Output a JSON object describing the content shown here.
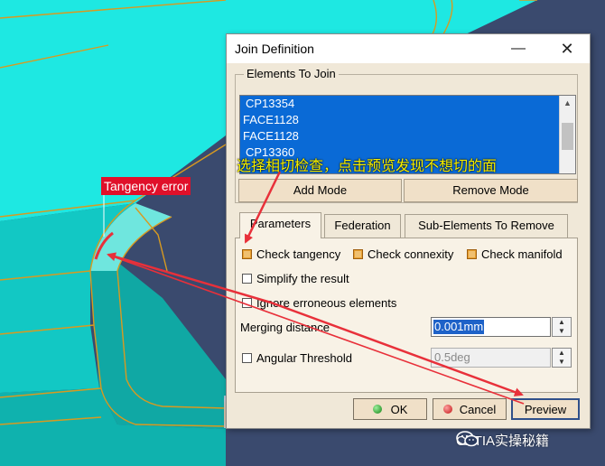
{
  "window": {
    "title": "Join Definition",
    "minimize_glyph": "—",
    "close_glyph": "✕"
  },
  "elements_to_join": {
    "legend": "Elements To Join",
    "items": [
      "CP13354",
      "FACE1128",
      "FACE1128",
      "CP13360"
    ],
    "add_mode_label": "Add Mode",
    "remove_mode_label": "Remove Mode"
  },
  "tabs": [
    {
      "label": "Parameters",
      "active": true
    },
    {
      "label": "Federation",
      "active": false
    },
    {
      "label": "Sub-Elements To Remove",
      "active": false
    }
  ],
  "parameters": {
    "check_tangency": {
      "label": "Check tangency",
      "checked": true
    },
    "check_connexity": {
      "label": "Check connexity",
      "checked": true
    },
    "check_manifold": {
      "label": "Check manifold",
      "checked": true
    },
    "simplify": {
      "label": "Simplify the result",
      "checked": false
    },
    "ignore_erroneous": {
      "label": "Ignore erroneous elements",
      "checked": false
    },
    "merging_distance": {
      "label": "Merging distance",
      "value": "0.001mm"
    },
    "angular_threshold": {
      "label": "Angular Threshold",
      "value": "0.5deg",
      "checked": false
    }
  },
  "buttons": {
    "ok": "OK",
    "cancel": "Cancel",
    "preview": "Preview"
  },
  "annotations": {
    "instruction": "选择相切检查，点击预览发现不想切的面",
    "tangency_error": "Tangency error",
    "watermark": "CATIA实操秘籍"
  },
  "colors": {
    "viewport_surface": "#18e6e0",
    "selection_blue": "#0a6ad6",
    "annotation_yellow": "#f6f000",
    "error_red": "#e0102a",
    "arrow_red": "#e8303a"
  },
  "icons": [
    "minimize-icon",
    "close-icon",
    "scroll-up-icon",
    "spin-up-icon",
    "spin-down-icon",
    "ok-ball-icon",
    "cancel-ball-icon",
    "wechat-icon"
  ]
}
